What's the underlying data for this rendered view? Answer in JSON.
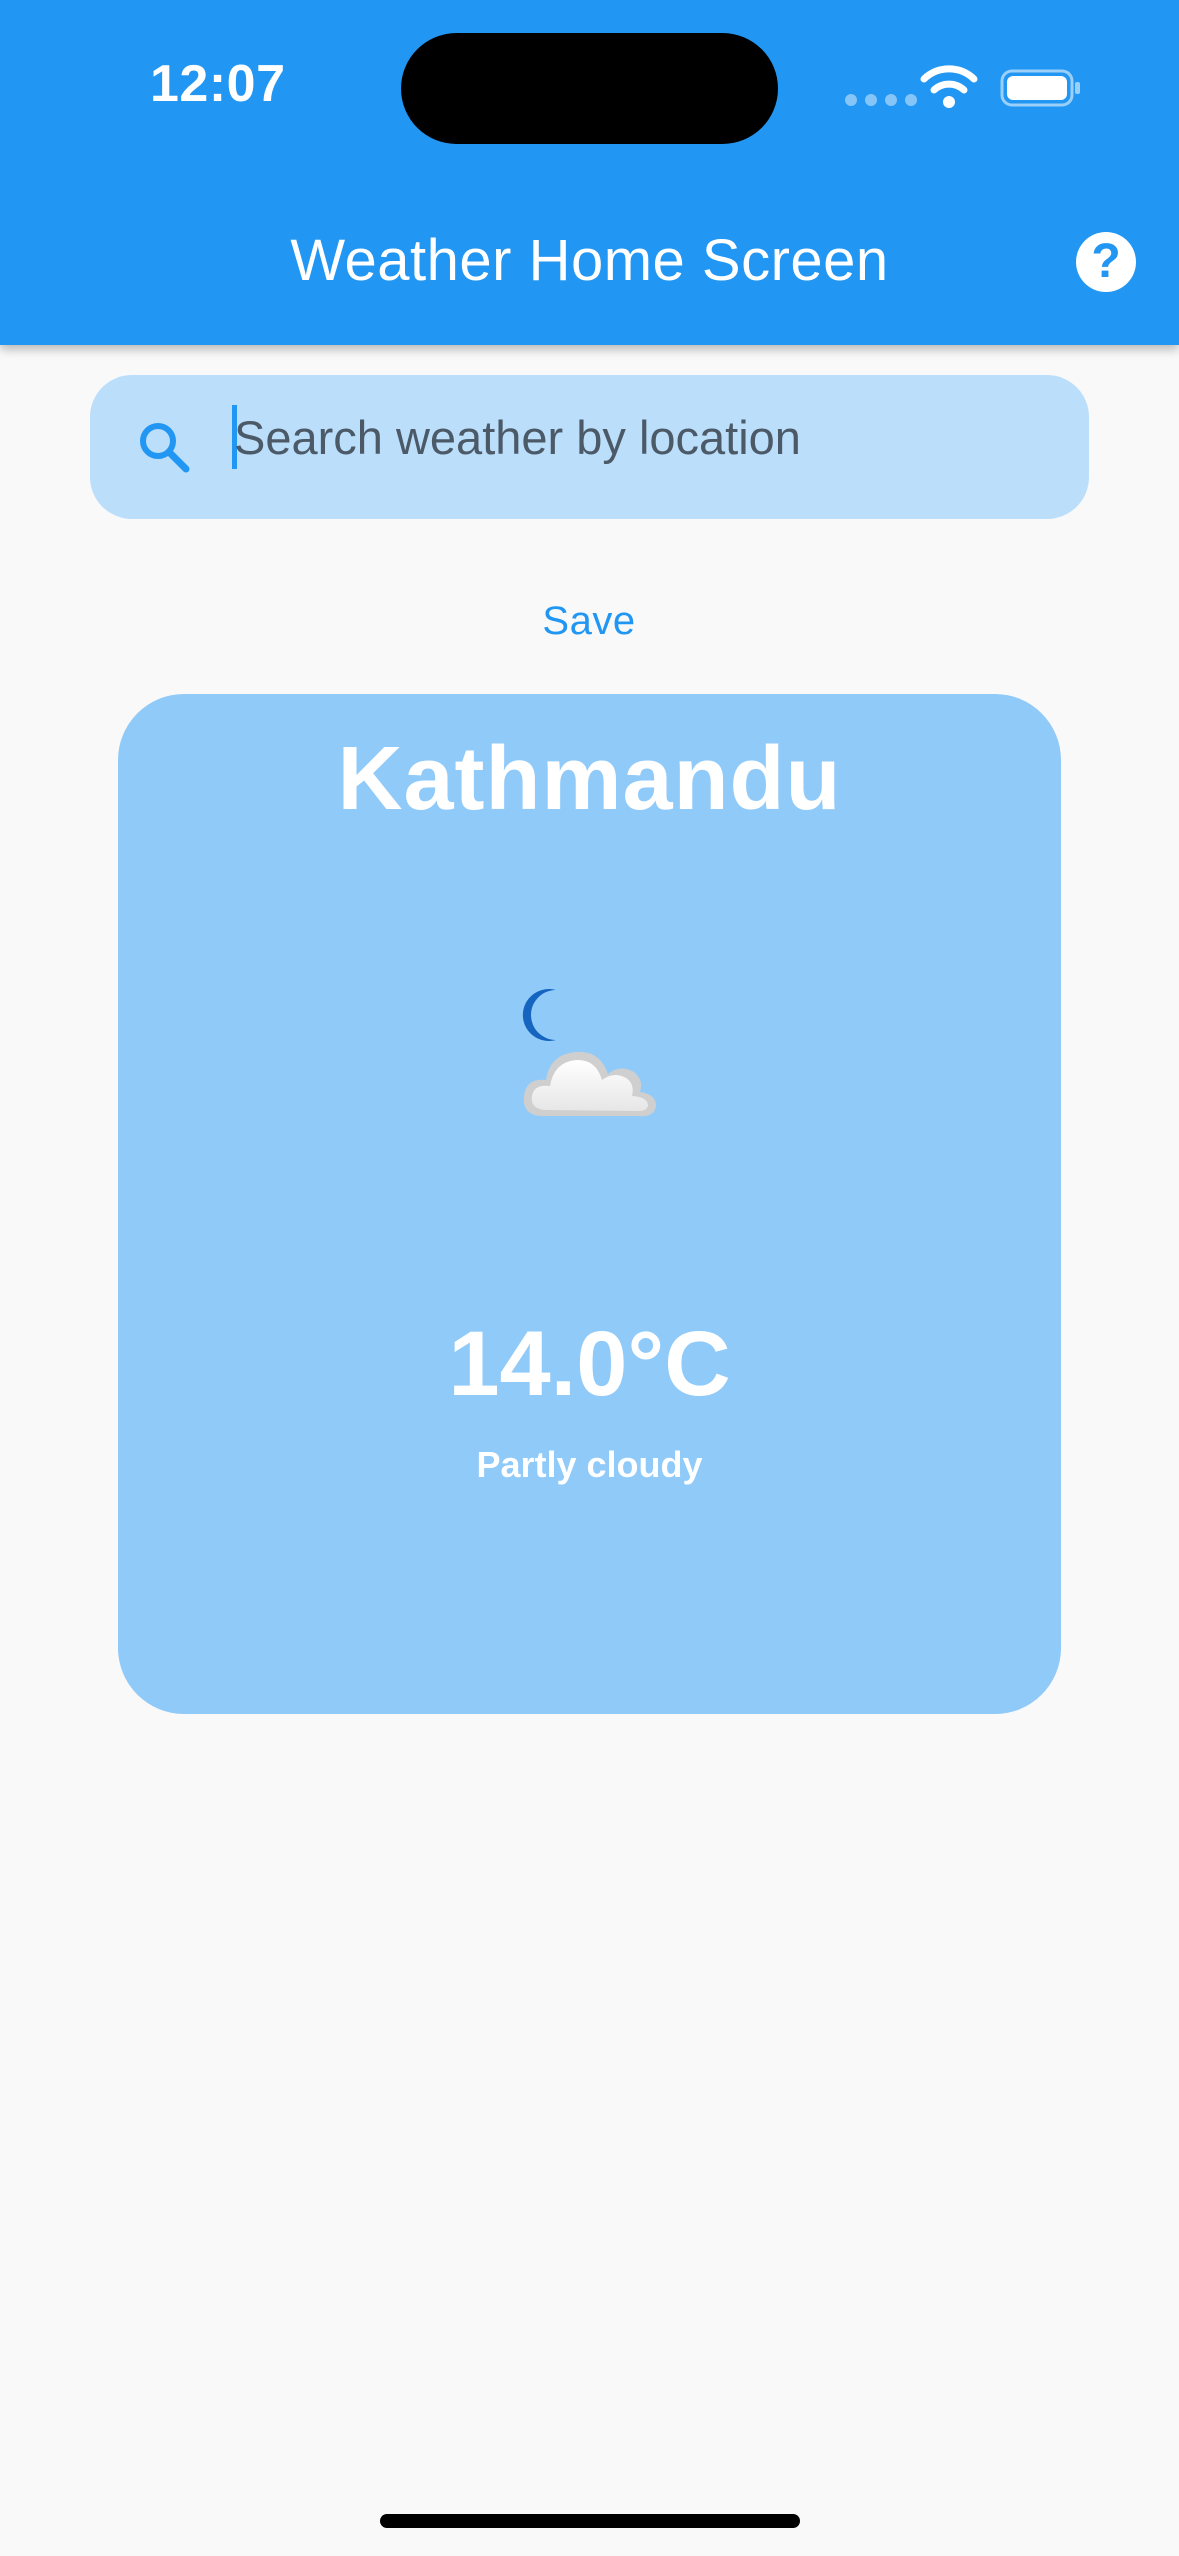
{
  "status_bar": {
    "time": "12:07",
    "icons": [
      "cellular-dots-icon",
      "wifi-icon",
      "battery-icon"
    ]
  },
  "app_bar": {
    "title": "Weather Home Screen",
    "help_icon": "help-circle-icon",
    "help_glyph": "?",
    "background_color": "#2196f3"
  },
  "search": {
    "placeholder": "Search weather by location",
    "value": "",
    "icon": "search-icon",
    "background_color": "#bbdefb"
  },
  "actions": {
    "save_label": "Save"
  },
  "weather_card": {
    "city": "Kathmandu",
    "icon": "moon-cloud-icon",
    "temperature": "14.0°C",
    "condition": "Partly cloudy",
    "background_color": "#90caf9"
  },
  "colors": {
    "accent": "#2196f3",
    "text_on_primary": "#ffffff",
    "page_background": "#f9f9f9"
  }
}
